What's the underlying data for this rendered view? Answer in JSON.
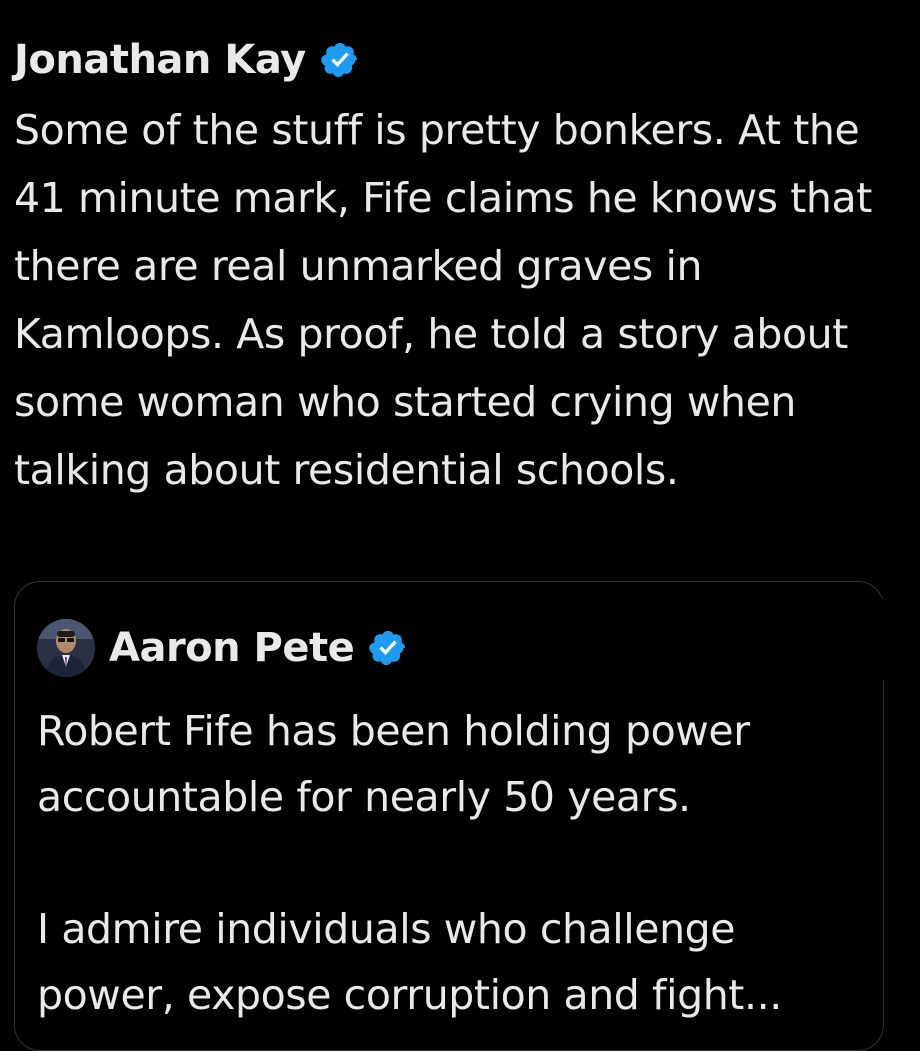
{
  "tweet": {
    "author_name": "Jonathan Kay",
    "verified_icon": "verified-badge-icon",
    "text": "Some of the stuff is pretty bonkers. At the 41 minute mark, Fife claims he knows that there are real unmarked graves in Kamloops. As proof, he told a story about some woman who started crying when talking about residential schools."
  },
  "quote": {
    "author_name": "Aaron Pete",
    "verified_icon": "verified-badge-icon",
    "paragraph_1": "Robert Fife has been holding power accountable for nearly 50 years.",
    "paragraph_2": "I admire individuals who challenge power, expose corruption and fight..."
  },
  "colors": {
    "background": "#000000",
    "text": "#e7e9ea",
    "verified_blue": "#1d9bf0",
    "border": "#2f3336"
  }
}
